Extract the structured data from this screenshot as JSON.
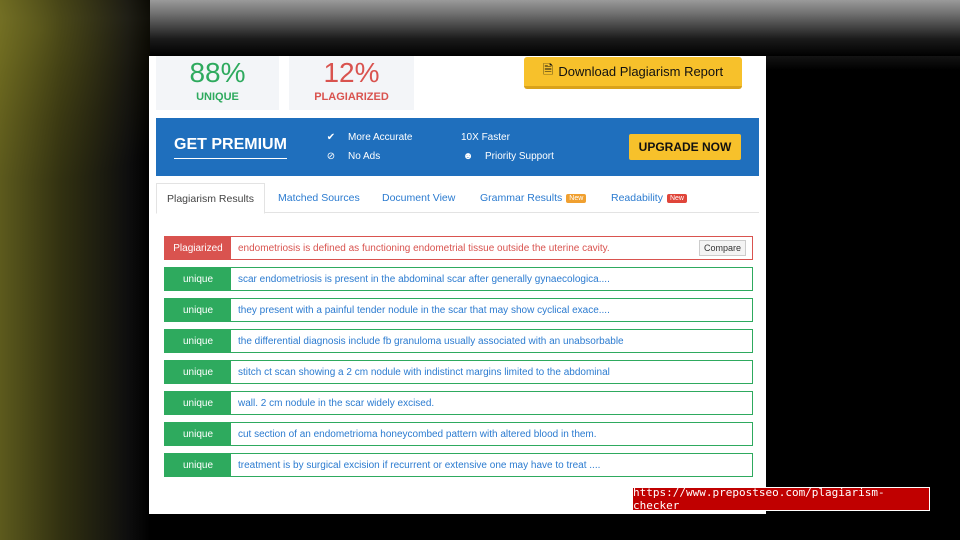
{
  "summary": {
    "unique_value": "88%",
    "unique_label": "UNIQUE",
    "plagiarized_value": "12%",
    "plagiarized_label": "PLAGIARIZED",
    "download_label": "Download Plagiarism Report"
  },
  "premium": {
    "title": "GET PREMIUM",
    "features": [
      "More Accurate",
      "No Ads",
      "10X Faster",
      "Priority Support"
    ],
    "upgrade_label": "UPGRADE NOW"
  },
  "tabs": [
    {
      "label": "Plagiarism Results",
      "active": true
    },
    {
      "label": "Matched Sources"
    },
    {
      "label": "Document View"
    },
    {
      "label": "Grammar Results",
      "badge": "New"
    },
    {
      "label": "Readability",
      "badge": "New"
    }
  ],
  "results": [
    {
      "status": "Plagiarized",
      "text": "endometriosis is defined as functioning endometrial tissue outside the uterine cavity.",
      "action": "Compare"
    },
    {
      "status": "unique",
      "text": "scar endometriosis is present in the abdominal scar after generally gynaecologica...."
    },
    {
      "status": "unique",
      "text": "they present with a painful tender nodule in the scar that may show cyclical exace...."
    },
    {
      "status": "unique",
      "text": "the differential diagnosis include fb granuloma usually associated with an unabsorbable"
    },
    {
      "status": "unique",
      "text": "stitch ct scan showing a 2 cm nodule with indistinct margins limited to the abdominal"
    },
    {
      "status": "unique",
      "text": "wall. 2 cm nodule in the scar widely excised."
    },
    {
      "status": "unique",
      "text": "cut section of an endometrioma honeycombed pattern with altered blood in them."
    },
    {
      "status": "unique",
      "text": "treatment is by surgical excision if recurrent or extensive one may have to treat ...."
    }
  ],
  "caption": {
    "url": "https://www.prepostseo.com/plagiarism-checker"
  },
  "colors": {
    "unique": "#2eaa5e",
    "plagiarized": "#d9534f",
    "premium_bg": "#1f6fbd",
    "accent_yellow": "#f7c12b",
    "link_blue": "#2b7bd0",
    "badge_new_orange": "#f0a030",
    "badge_new_red": "#e0453a"
  },
  "icons": [
    "document-icon",
    "check-icon",
    "no-ads-icon",
    "users-icon"
  ]
}
